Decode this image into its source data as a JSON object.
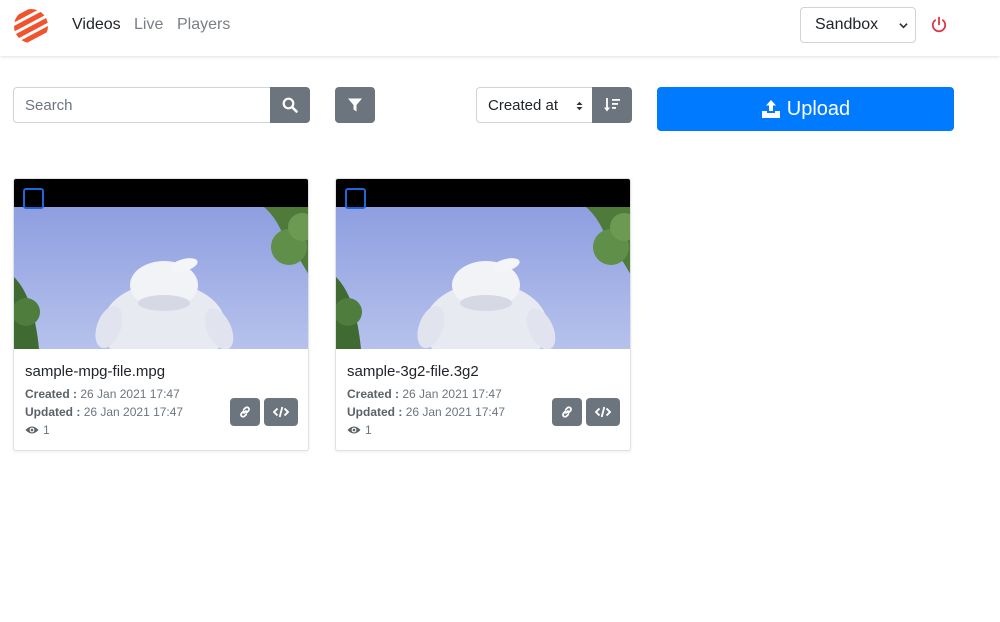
{
  "nav": {
    "items": [
      {
        "label": "Videos",
        "active": true
      },
      {
        "label": "Live",
        "active": false
      },
      {
        "label": "Players",
        "active": false
      }
    ],
    "environment": "Sandbox"
  },
  "toolbar": {
    "search_placeholder": "Search",
    "search_value": "",
    "sort_label": "Created at",
    "upload_label": "Upload"
  },
  "videos": [
    {
      "title": "sample-mpg-file.mpg",
      "created_label": "Created :",
      "created": "26 Jan 2021 17:47",
      "updated_label": "Updated :",
      "updated": "26 Jan 2021 17:47",
      "views": "1"
    },
    {
      "title": "sample-3g2-file.3g2",
      "created_label": "Created :",
      "created": "26 Jan 2021 17:47",
      "updated_label": "Updated :",
      "updated": "26 Jan 2021 17:47",
      "views": "1"
    }
  ],
  "icons": [
    "logo-icon",
    "chevron-down-icon",
    "power-icon",
    "search-icon",
    "filter-icon",
    "sort-updown-icon",
    "sort-direction-icon",
    "upload-icon",
    "link-icon",
    "code-icon",
    "eye-icon"
  ],
  "colors": {
    "primary": "#007bff",
    "secondary": "#6c757d",
    "power": "#dc3545",
    "logo": "#f0532d"
  }
}
